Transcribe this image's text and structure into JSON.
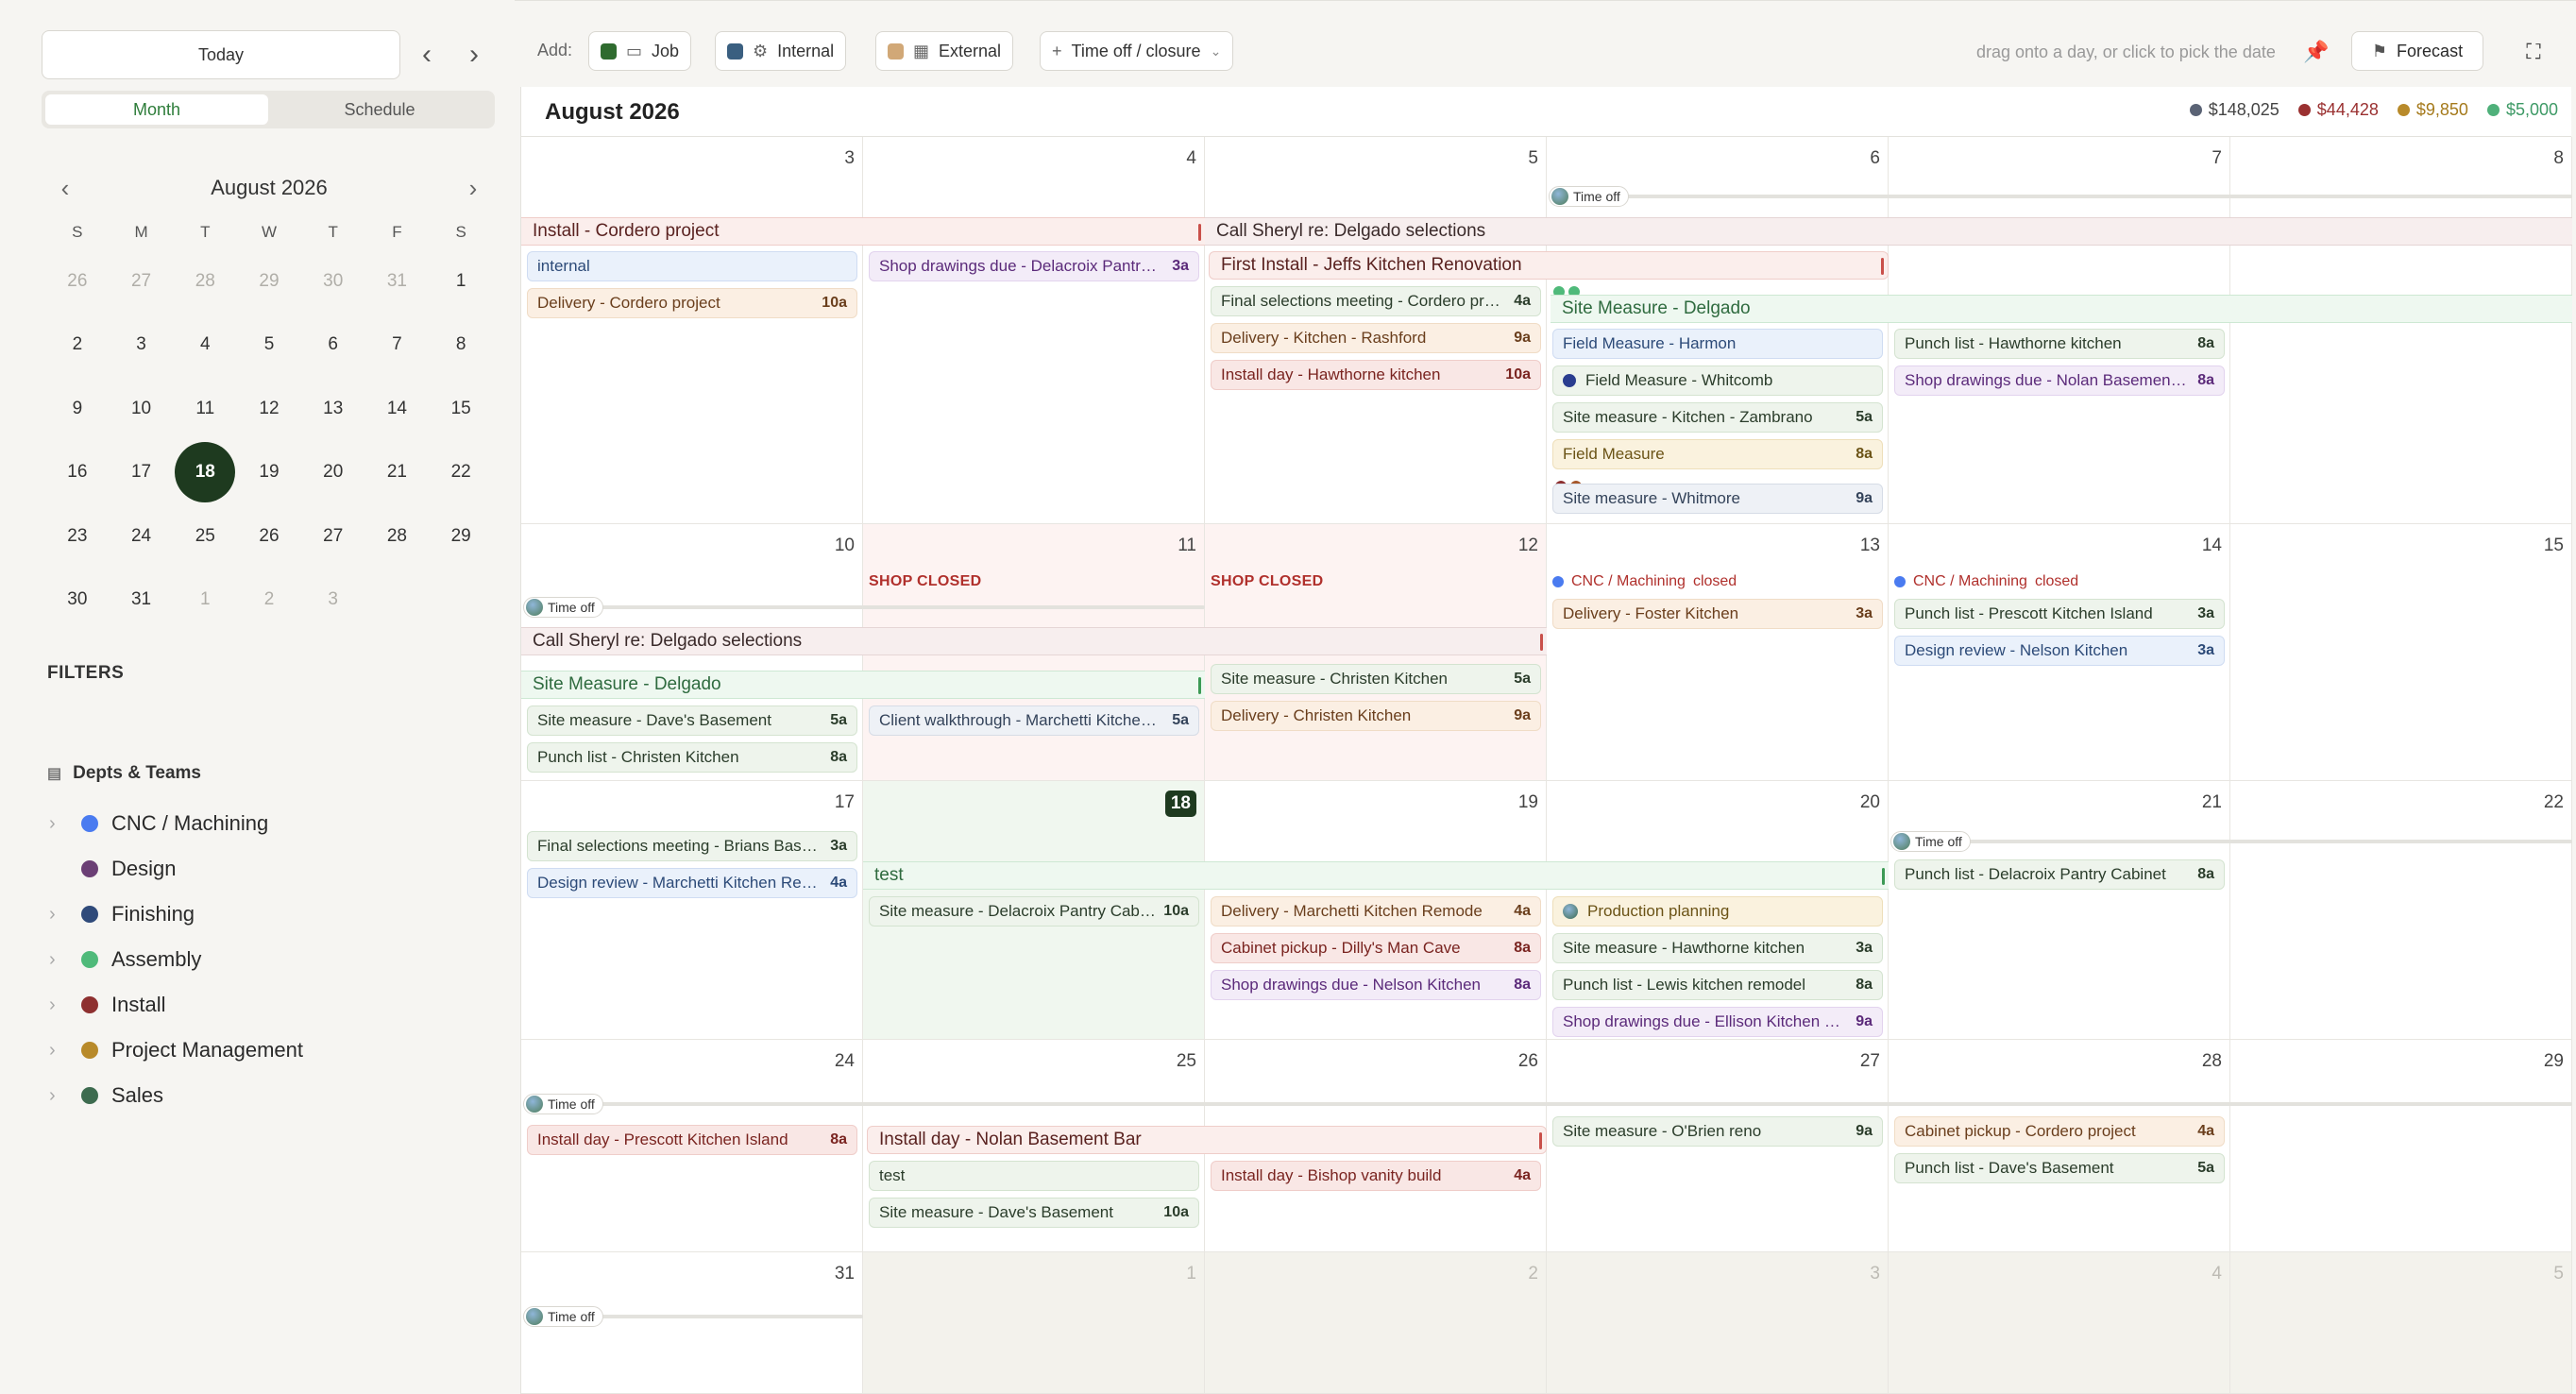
{
  "sidebar": {
    "today_label": "Today",
    "views": [
      "Month",
      "Schedule"
    ],
    "mini_title": "August 2026",
    "dow": [
      "S",
      "M",
      "T",
      "W",
      "T",
      "F",
      "S"
    ],
    "weeks": [
      [
        "26",
        "27",
        "28",
        "29",
        "30",
        "31",
        "1"
      ],
      [
        "2",
        "3",
        "4",
        "5",
        "6",
        "7",
        "8"
      ],
      [
        "9",
        "10",
        "11",
        "12",
        "13",
        "14",
        "15"
      ],
      [
        "16",
        "17",
        "18",
        "19",
        "20",
        "21",
        "22"
      ],
      [
        "23",
        "24",
        "25",
        "26",
        "27",
        "28",
        "29"
      ],
      [
        "30",
        "31",
        "1",
        "2",
        "3"
      ]
    ],
    "filters_title": "FILTERS",
    "depts_title": "Depts & Teams",
    "depts": [
      {
        "label": "CNC / Machining",
        "color": "#4a7bf0"
      },
      {
        "label": "Design",
        "color": "#6b3f75"
      },
      {
        "label": "Finishing",
        "color": "#2f4a7a"
      },
      {
        "label": "Assembly",
        "color": "#4fba7a"
      },
      {
        "label": "Install",
        "color": "#8e3030"
      },
      {
        "label": "Project Management",
        "color": "#b88a2a"
      },
      {
        "label": "Sales",
        "color": "#3d6b4f"
      }
    ]
  },
  "toolbar": {
    "add_label": "Add:",
    "job": "Job",
    "internal": "Internal",
    "external": "External",
    "timeoff": "Time off / closure",
    "hint": "drag onto a day, or click to pick the date",
    "forecast": "Forecast",
    "colors": {
      "job": "#2f6b2f",
      "internal": "#3a5f80",
      "external": "#d1a877"
    }
  },
  "calendar": {
    "title": "August 2026",
    "totals": [
      {
        "value": "$148,025",
        "color": "#5a6375"
      },
      {
        "value": "$44,428",
        "color": "#9a3030"
      },
      {
        "value": "$9,850",
        "color": "#b88a2a"
      },
      {
        "value": "$5,000",
        "color": "#4fb07a"
      }
    ],
    "day_numbers": [
      "3",
      "4",
      "5",
      "6",
      "7",
      "8",
      "10",
      "11",
      "12",
      "13",
      "14",
      "15",
      "17",
      "18",
      "19",
      "20",
      "21",
      "22",
      "24",
      "25",
      "26",
      "27",
      "28",
      "29",
      "31",
      "1",
      "2",
      "3",
      "4",
      "5"
    ],
    "shop_closed": "SHOP CLOSED",
    "cnc_closed": "CNC / Machining",
    "closed_word": "closed",
    "timeoff": "Time off",
    "bars": [
      "Install - Cordero project",
      "Call Sheryl re: Delgado selections",
      "First Install - Jeffs Kitchen Renovation",
      "Site Measure - Delgado",
      "Call Sheryl re: Delgado selections",
      "Site Measure - Delgado",
      "test",
      "Install day - Nolan Basement Bar"
    ],
    "events": [
      {
        "text": "internal",
        "time": ""
      },
      {
        "text": "Delivery - Cordero project",
        "time": "10a"
      },
      {
        "text": "Shop drawings due - Delacroix Pantry Cabinet",
        "time": "3a"
      },
      {
        "text": "Final selections meeting - Cordero project",
        "time": "4a"
      },
      {
        "text": "Delivery - Kitchen - Rashford",
        "time": "9a"
      },
      {
        "text": "Install day - Hawthorne kitchen",
        "time": "10a"
      },
      {
        "text": "Field Measure - Harmon",
        "time": ""
      },
      {
        "text": "Field Measure - Whitcomb",
        "time": ""
      },
      {
        "text": "Site measure - Kitchen - Zambrano",
        "time": "5a"
      },
      {
        "text": "Field Measure",
        "time": "8a"
      },
      {
        "text": "Site measure - Whitmore",
        "time": "9a"
      },
      {
        "text": "Punch list - Hawthorne kitchen",
        "time": "8a"
      },
      {
        "text": "Shop drawings due - Nolan Basement Bar",
        "time": "8a"
      },
      {
        "text": "Site measure - Dave's Basement",
        "time": "5a"
      },
      {
        "text": "Punch list - Christen Kitchen",
        "time": "8a"
      },
      {
        "text": "Client walkthrough - Marchetti Kitchen Remode",
        "time": "5a"
      },
      {
        "text": "Site measure - Christen Kitchen",
        "time": "5a"
      },
      {
        "text": "Delivery - Christen Kitchen",
        "time": "9a"
      },
      {
        "text": "Delivery - Foster Kitchen",
        "time": "3a"
      },
      {
        "text": "Punch list - Prescott Kitchen Island",
        "time": "3a"
      },
      {
        "text": "Design review - Nelson Kitchen",
        "time": "3a"
      },
      {
        "text": "Final selections meeting - Brians Basement",
        "time": "3a"
      },
      {
        "text": "Design review - Marchetti Kitchen Remodel",
        "time": "4a"
      },
      {
        "text": "Site measure - Delacroix Pantry Cabinet",
        "time": "10a"
      },
      {
        "text": "Delivery - Marchetti Kitchen Remode",
        "time": "4a"
      },
      {
        "text": "Cabinet pickup - Dilly's Man Cave",
        "time": "8a"
      },
      {
        "text": "Shop drawings due - Nelson Kitchen",
        "time": "8a"
      },
      {
        "text": "Production planning",
        "time": ""
      },
      {
        "text": "Site measure - Hawthorne kitchen",
        "time": "3a"
      },
      {
        "text": "Punch list - Lewis kitchen remodel",
        "time": "8a"
      },
      {
        "text": "Shop drawings due - Ellison Kitchen Remodel",
        "time": "9a"
      },
      {
        "text": "Punch list - Delacroix Pantry Cabinet",
        "time": "8a"
      },
      {
        "text": "Install day - Prescott Kitchen Island",
        "time": "8a"
      },
      {
        "text": "test",
        "time": ""
      },
      {
        "text": "Site measure - Dave's Basement",
        "time": "10a"
      },
      {
        "text": "Install day - Bishop vanity build",
        "time": "4a"
      },
      {
        "text": "Site measure - O'Brien reno",
        "time": "9a"
      },
      {
        "text": "Cabinet pickup - Cordero project",
        "time": "4a"
      },
      {
        "text": "Punch list - Dave's Basement",
        "time": "5a"
      }
    ]
  }
}
